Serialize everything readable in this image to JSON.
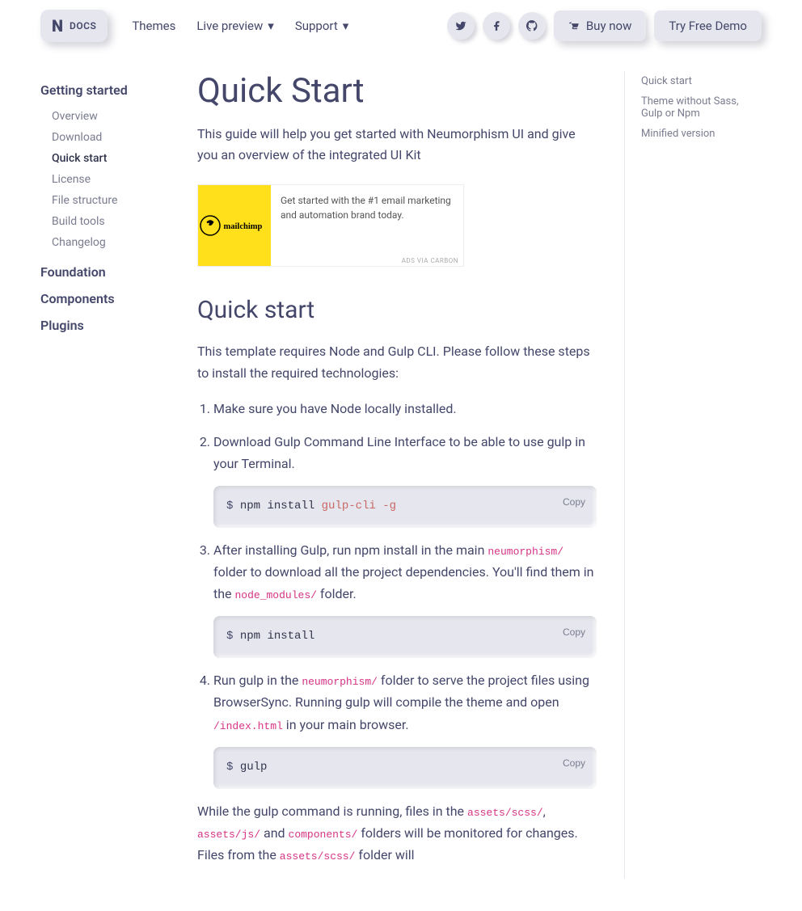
{
  "header": {
    "brand_letter": "N",
    "brand_docs": "DOCS",
    "nav": {
      "themes": "Themes",
      "live_preview": "Live preview",
      "support": "Support"
    },
    "buy": "Buy now",
    "demo": "Try Free Demo"
  },
  "sidebar": {
    "section1": "Getting started",
    "items1": [
      "Overview",
      "Download",
      "Quick start",
      "License",
      "File structure",
      "Build tools",
      "Changelog"
    ],
    "section2": "Foundation",
    "section3": "Components",
    "section4": "Plugins"
  },
  "page": {
    "title": "Quick Start",
    "lead": "This guide will help you get started with Neumorphism UI and give you an overview of the integrated UI Kit"
  },
  "ad": {
    "text": "Get started with the #1 email marketing and automation brand today.",
    "via": "ADS VIA CARBON"
  },
  "section": {
    "heading": "Quick start",
    "intro": "This template requires Node and Gulp CLI. Please follow these steps to install the required technologies:",
    "li1": "Make sure you have Node locally installed.",
    "li2": "Download Gulp Command Line Interface to be able to use gulp in your Terminal.",
    "code1_a": "npm",
    "code1_b": "install",
    "code1_c": "gulp-cli -g",
    "li3_pre": "After installing Gulp, run npm install in the main ",
    "li3_code1": "neumorphism/",
    "li3_mid1": " folder to download all the project dependencies. You'll find them in the ",
    "li3_code2": "node_modules/",
    "li3_tail": " folder.",
    "code2_a": "npm",
    "code2_b": "install",
    "li4_pre": "Run gulp in the ",
    "li4_code1": "neumorphism/",
    "li4_mid": " folder to serve the project files using BrowserSync. Running gulp will compile the theme and open ",
    "li4_code2": "/index.html",
    "li4_tail": " in your main browser.",
    "code3_a": "gulp",
    "p4_a": "While the gulp command is running, files in the ",
    "p4_c1": "assets/scss/",
    "p4_b": ", ",
    "p4_c2": "assets/js/",
    "p4_c": " and ",
    "p4_c3": "components/",
    "p4_d": " folders will be monitored for changes. Files from the ",
    "p4_c4": "assets/scss/",
    "p4_e": " folder will",
    "copy": "Copy"
  },
  "toc": {
    "i1": "Quick start",
    "i2": "Theme without Sass, Gulp or Npm",
    "i3": "Minified version"
  }
}
